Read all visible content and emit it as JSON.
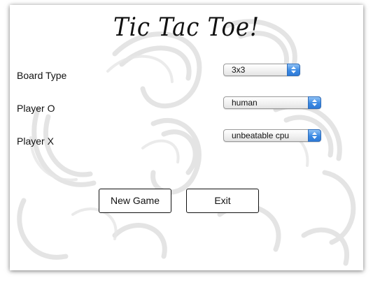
{
  "window": {
    "title": "Tic Tac Toe!"
  },
  "form": {
    "rows": [
      {
        "label": "Board Type",
        "selected": "3x3"
      },
      {
        "label": "Player O",
        "selected": "human"
      },
      {
        "label": "Player X",
        "selected": "unbeatable cpu"
      }
    ]
  },
  "buttons": {
    "new_game": "New Game",
    "exit": "Exit"
  },
  "icons": {
    "select_stepper": "up-down-arrows-icon"
  },
  "colors": {
    "stepper_blue": "#3b8ae4",
    "background": "#ffffff",
    "text": "#111111"
  }
}
